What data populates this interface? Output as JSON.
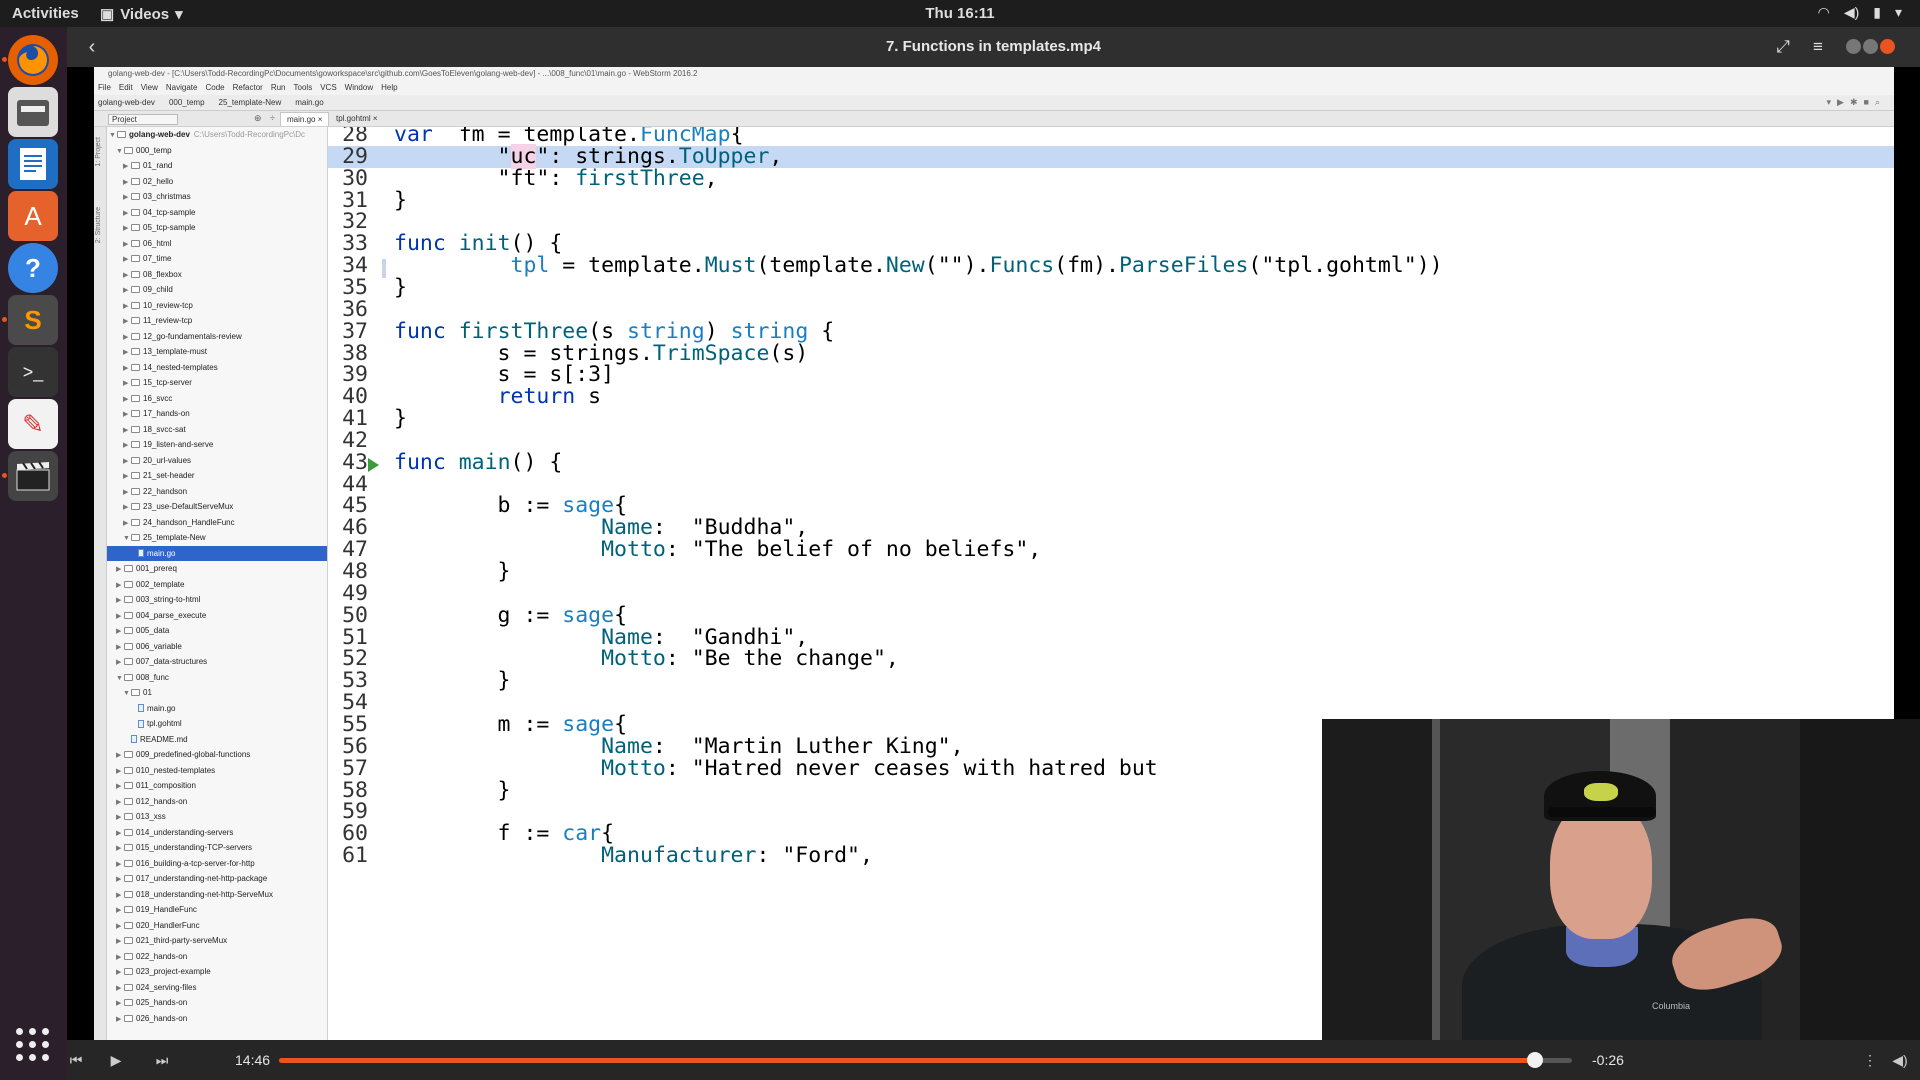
{
  "topbar": {
    "activities": "Activities",
    "app_menu": "Videos",
    "clock": "Thu 16:11"
  },
  "dock": {
    "items": [
      {
        "name": "Firefox",
        "icon": "firefox-icon"
      },
      {
        "name": "Files",
        "icon": "files-icon"
      },
      {
        "name": "LibreOffice Writer",
        "icon": "document-icon"
      },
      {
        "name": "Ubuntu Software",
        "icon": "software-store-icon"
      },
      {
        "name": "Help",
        "icon": "help-icon"
      },
      {
        "name": "Sublime Text",
        "icon": "sublime-icon"
      },
      {
        "name": "Terminal",
        "icon": "terminal-icon"
      },
      {
        "name": "Text Editor",
        "icon": "text-editor-icon"
      },
      {
        "name": "Videos",
        "icon": "videos-icon"
      }
    ],
    "colors": {
      "background": "#2a1f2a",
      "accent": "#e95420"
    }
  },
  "player": {
    "title": "7. Functions in templates.mp4",
    "elapsed": "14:46",
    "remaining": "-0:26",
    "progress_fraction": 0.971
  },
  "ide": {
    "window_title": "golang-web-dev - [C:\\Users\\Todd-RecordingPc\\Documents\\goworkspace\\src\\github.com\\GoesToEleven\\golang-web-dev] - ...\\008_func\\01\\main.go - WebStorm 2016.2",
    "menu": [
      "File",
      "Edit",
      "View",
      "Navigate",
      "Code",
      "Refactor",
      "Run",
      "Tools",
      "VCS",
      "Window",
      "Help"
    ],
    "nav": [
      "golang-web-dev",
      "000_temp",
      "25_template-New",
      "main.go"
    ],
    "project_selector": "Project",
    "tabs": [
      {
        "label": "main.go",
        "active": true
      },
      {
        "label": "tpl.gohtml",
        "active": false
      }
    ],
    "side_tools": [
      "1: Project",
      "2: Structure"
    ],
    "tree_root": "golang-web-dev",
    "tree_root_hint": "C:\\Users\\Todd-RecordingPc\\Dc",
    "tree": [
      {
        "label": "000_temp",
        "level": 1,
        "expanded": true
      },
      {
        "label": "01_rand",
        "level": 2
      },
      {
        "label": "02_hello",
        "level": 2
      },
      {
        "label": "03_christmas",
        "level": 2
      },
      {
        "label": "04_tcp-sample",
        "level": 2
      },
      {
        "label": "05_tcp-sample",
        "level": 2
      },
      {
        "label": "06_html",
        "level": 2
      },
      {
        "label": "07_time",
        "level": 2
      },
      {
        "label": "08_flexbox",
        "level": 2
      },
      {
        "label": "09_child",
        "level": 2
      },
      {
        "label": "10_review-tcp",
        "level": 2
      },
      {
        "label": "11_review-tcp",
        "level": 2
      },
      {
        "label": "12_go-fundamentals-review",
        "level": 2
      },
      {
        "label": "13_template-must",
        "level": 2
      },
      {
        "label": "14_nested-templates",
        "level": 2
      },
      {
        "label": "15_tcp-server",
        "level": 2
      },
      {
        "label": "16_svcc",
        "level": 2
      },
      {
        "label": "17_hands-on",
        "level": 2
      },
      {
        "label": "18_svcc-sat",
        "level": 2
      },
      {
        "label": "19_listen-and-serve",
        "level": 2
      },
      {
        "label": "20_url-values",
        "level": 2
      },
      {
        "label": "21_set-header",
        "level": 2
      },
      {
        "label": "22_handson",
        "level": 2
      },
      {
        "label": "23_use-DefaultServeMux",
        "level": 2
      },
      {
        "label": "24_handson_HandleFunc",
        "level": 2
      },
      {
        "label": "25_template-New",
        "level": 2,
        "expanded": true
      },
      {
        "label": "main.go",
        "level": 3,
        "file": true,
        "selected": true
      },
      {
        "label": "001_prereq",
        "level": 1
      },
      {
        "label": "002_template",
        "level": 1
      },
      {
        "label": "003_string-to-html",
        "level": 1
      },
      {
        "label": "004_parse_execute",
        "level": 1
      },
      {
        "label": "005_data",
        "level": 1
      },
      {
        "label": "006_variable",
        "level": 1
      },
      {
        "label": "007_data-structures",
        "level": 1
      },
      {
        "label": "008_func",
        "level": 1,
        "expanded": true
      },
      {
        "label": "01",
        "level": 2,
        "expanded": true
      },
      {
        "label": "main.go",
        "level": 3,
        "file": true
      },
      {
        "label": "tpl.gohtml",
        "level": 3,
        "file": true
      },
      {
        "label": "README.md",
        "level": 2,
        "file": true
      },
      {
        "label": "009_predefined-global-functions",
        "level": 1
      },
      {
        "label": "010_nested-templates",
        "level": 1
      },
      {
        "label": "011_composition",
        "level": 1
      },
      {
        "label": "012_hands-on",
        "level": 1
      },
      {
        "label": "013_xss",
        "level": 1
      },
      {
        "label": "014_understanding-servers",
        "level": 1
      },
      {
        "label": "015_understanding-TCP-servers",
        "level": 1
      },
      {
        "label": "016_building-a-tcp-server-for-http",
        "level": 1
      },
      {
        "label": "017_understanding-net-http-package",
        "level": 1
      },
      {
        "label": "018_understanding-net-http-ServeMux",
        "level": 1
      },
      {
        "label": "019_HandleFunc",
        "level": 1
      },
      {
        "label": "020_HandlerFunc",
        "level": 1
      },
      {
        "label": "021_third-party-serveMux",
        "level": 1
      },
      {
        "label": "022_hands-on",
        "level": 1
      },
      {
        "label": "023_project-example",
        "level": 1
      },
      {
        "label": "024_serving-files",
        "level": 1
      },
      {
        "label": "025_hands-on",
        "level": 1
      },
      {
        "label": "026_hands-on",
        "level": 1
      }
    ],
    "code": [
      {
        "n": "28",
        "tokens": [
          [
            "kw",
            "var"
          ],
          [
            "",
            "  fm = template."
          ],
          [
            "ty",
            "FuncMap"
          ],
          [
            "",
            "{"
          ]
        ]
      },
      {
        "n": "29",
        "hl": true,
        "tokens": [
          [
            "",
            "        \""
          ],
          [
            "strhl",
            "uc"
          ],
          [
            "",
            "\": strings."
          ],
          [
            "fn",
            "ToUpper"
          ],
          [
            "",
            ","
          ]
        ]
      },
      {
        "n": "30",
        "tokens": [
          [
            "",
            "        \"ft\": "
          ],
          [
            "fn",
            "firstThree"
          ],
          [
            "",
            ","
          ]
        ]
      },
      {
        "n": "31",
        "tokens": [
          [
            "",
            "}"
          ]
        ]
      },
      {
        "n": "32",
        "tokens": []
      },
      {
        "n": "33",
        "tokens": [
          [
            "kw",
            "func"
          ],
          [
            "",
            " "
          ],
          [
            "fn",
            "init"
          ],
          [
            "",
            "() {"
          ]
        ]
      },
      {
        "n": "34",
        "mark": true,
        "tokens": [
          [
            "",
            "         "
          ],
          [
            "ty",
            "tpl"
          ],
          [
            "",
            " = template."
          ],
          [
            "fn",
            "Must"
          ],
          [
            "",
            "(template."
          ],
          [
            "fn",
            "New"
          ],
          [
            "",
            "(\"\")."
          ],
          [
            "fn",
            "Funcs"
          ],
          [
            "",
            "(fm)."
          ],
          [
            "fn",
            "ParseFiles"
          ],
          [
            "",
            "(\"tpl.gohtml\"))"
          ]
        ]
      },
      {
        "n": "35",
        "tokens": [
          [
            "",
            "}"
          ]
        ]
      },
      {
        "n": "36",
        "tokens": []
      },
      {
        "n": "37",
        "tokens": [
          [
            "kw",
            "func"
          ],
          [
            "",
            " "
          ],
          [
            "fn",
            "firstThree"
          ],
          [
            "",
            "(s "
          ],
          [
            "ty",
            "string"
          ],
          [
            "",
            ") "
          ],
          [
            "ty",
            "string"
          ],
          [
            "",
            " {"
          ]
        ]
      },
      {
        "n": "38",
        "tokens": [
          [
            "",
            "        s = strings."
          ],
          [
            "fn",
            "TrimSpace"
          ],
          [
            "",
            "(s)"
          ]
        ]
      },
      {
        "n": "39",
        "tokens": [
          [
            "",
            "        s = s[:3]"
          ]
        ]
      },
      {
        "n": "40",
        "tokens": [
          [
            "",
            "        "
          ],
          [
            "kw",
            "return"
          ],
          [
            "",
            " s"
          ]
        ]
      },
      {
        "n": "41",
        "tokens": [
          [
            "",
            "}"
          ]
        ]
      },
      {
        "n": "42",
        "tokens": []
      },
      {
        "n": "43",
        "run": true,
        "tokens": [
          [
            "kw",
            "func"
          ],
          [
            "",
            " "
          ],
          [
            "fn",
            "main"
          ],
          [
            "",
            "() {"
          ]
        ]
      },
      {
        "n": "44",
        "tokens": []
      },
      {
        "n": "45",
        "tokens": [
          [
            "",
            "        b := "
          ],
          [
            "ty",
            "sage"
          ],
          [
            "",
            "{"
          ]
        ]
      },
      {
        "n": "46",
        "tokens": [
          [
            "",
            "                "
          ],
          [
            "fn",
            "Name"
          ],
          [
            "",
            ":  \"Buddha\","
          ]
        ]
      },
      {
        "n": "47",
        "tokens": [
          [
            "",
            "                "
          ],
          [
            "fn",
            "Motto"
          ],
          [
            "",
            ": \"The belief of no beliefs\","
          ]
        ]
      },
      {
        "n": "48",
        "tokens": [
          [
            "",
            "        }"
          ]
        ]
      },
      {
        "n": "49",
        "tokens": []
      },
      {
        "n": "50",
        "tokens": [
          [
            "",
            "        g := "
          ],
          [
            "ty",
            "sage"
          ],
          [
            "",
            "{"
          ]
        ]
      },
      {
        "n": "51",
        "tokens": [
          [
            "",
            "                "
          ],
          [
            "fn",
            "Name"
          ],
          [
            "",
            ":  \"Gandhi\","
          ]
        ]
      },
      {
        "n": "52",
        "tokens": [
          [
            "",
            "                "
          ],
          [
            "fn",
            "Motto"
          ],
          [
            "",
            ": \"Be the change\","
          ]
        ]
      },
      {
        "n": "53",
        "tokens": [
          [
            "",
            "        }"
          ]
        ]
      },
      {
        "n": "54",
        "tokens": []
      },
      {
        "n": "55",
        "tokens": [
          [
            "",
            "        m := "
          ],
          [
            "ty",
            "sage"
          ],
          [
            "",
            "{"
          ]
        ]
      },
      {
        "n": "56",
        "tokens": [
          [
            "",
            "                "
          ],
          [
            "fn",
            "Name"
          ],
          [
            "",
            ":  \"Martin Luther King\","
          ]
        ]
      },
      {
        "n": "57",
        "tokens": [
          [
            "",
            "                "
          ],
          [
            "fn",
            "Motto"
          ],
          [
            "",
            ": \"Hatred never ceases with hatred but"
          ]
        ]
      },
      {
        "n": "58",
        "tokens": [
          [
            "",
            "        }"
          ]
        ]
      },
      {
        "n": "59",
        "tokens": []
      },
      {
        "n": "60",
        "tokens": [
          [
            "",
            "        f := "
          ],
          [
            "ty",
            "car"
          ],
          [
            "",
            "{"
          ]
        ]
      },
      {
        "n": "61",
        "tokens": [
          [
            "",
            "                "
          ],
          [
            "fn",
            "Manufacturer"
          ],
          [
            "",
            ": \"Ford\","
          ]
        ]
      }
    ]
  },
  "webcam": {
    "brand": "Columbia"
  }
}
